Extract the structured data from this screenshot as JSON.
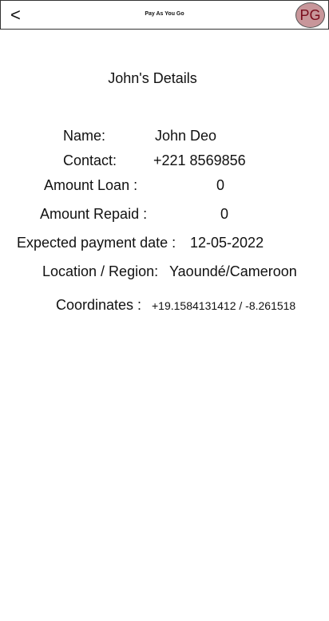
{
  "header": {
    "back_label": "<",
    "title": "Pay As You Go",
    "avatar_initials": "PG",
    "avatar_color": "#c8969a"
  },
  "details": {
    "title": "John's Details",
    "name_label": "Name:",
    "name_value": "John Deo",
    "contact_label": "Contact:",
    "contact_value": "+221 8569856",
    "amount_loan_label": "Amount Loan :",
    "amount_loan_value": "0",
    "amount_repaid_label": "Amount Repaid :",
    "amount_repaid_value": "0",
    "expected_date_label": "Expected payment date :",
    "expected_date_value": "12-05-2022",
    "location_label": "Location / Region:",
    "location_value": "Yaoundé/Cameroon",
    "coordinates_label": "Coordinates :",
    "coordinates_value": "+19.1584131412 / -8.261518"
  }
}
